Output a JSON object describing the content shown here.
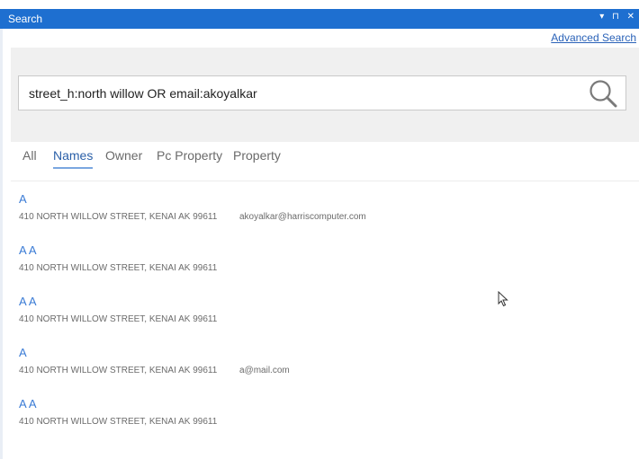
{
  "window": {
    "title": "Search",
    "controls": "▾ ⊓ ✕"
  },
  "advanced_search_label": "Advanced Search",
  "search": {
    "value": "street_h:north willow OR email:akoyalkar",
    "placeholder": ""
  },
  "tabs": [
    {
      "label": "All",
      "active": false
    },
    {
      "label": "Names",
      "active": true
    },
    {
      "label": "Owner",
      "active": false
    },
    {
      "label": "Pc Property",
      "active": false
    },
    {
      "label": "Property",
      "active": false
    }
  ],
  "results": [
    {
      "name": "A",
      "address": "410 NORTH WILLOW STREET, KENAI AK  99611",
      "email": "akoyalkar@harriscomputer.com"
    },
    {
      "name": "A A",
      "address": "410 NORTH WILLOW STREET, KENAI AK  99611",
      "email": ""
    },
    {
      "name": "A A",
      "address": "410 NORTH WILLOW STREET, KENAI AK  99611",
      "email": ""
    },
    {
      "name": "A",
      "address": "410 NORTH WILLOW STREET, KENAI AK  99611",
      "email": "a@mail.com"
    },
    {
      "name": "A A",
      "address": "410 NORTH WILLOW STREET, KENAI AK  99611",
      "email": ""
    }
  ],
  "colors": {
    "titlebar": "#1e6fd0",
    "accent": "#2a5fa8",
    "result_name": "#3a7bd5"
  }
}
